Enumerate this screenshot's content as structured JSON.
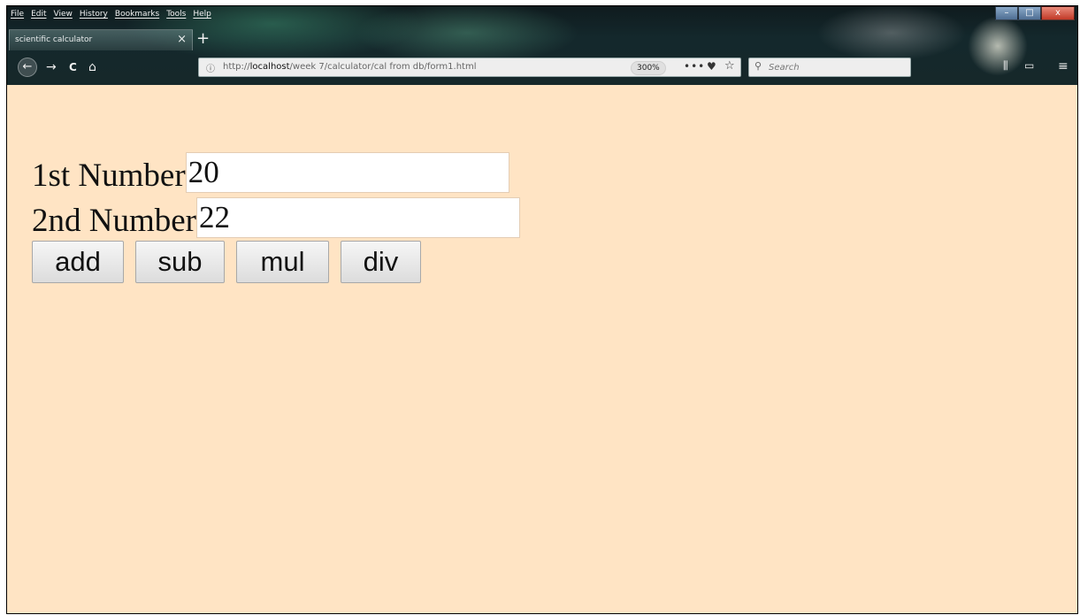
{
  "menubar": {
    "items": [
      "File",
      "Edit",
      "View",
      "History",
      "Bookmarks",
      "Tools",
      "Help"
    ]
  },
  "tab": {
    "title": "scientific calculator",
    "close_glyph": "×",
    "new_tab_glyph": "+"
  },
  "nav": {
    "back_glyph": "←",
    "forward_glyph": "→",
    "reload_glyph": "C",
    "home_glyph": "⌂",
    "url_prefix": "http://",
    "url_host": "localhost",
    "url_path": "/week 7/calculator/cal from db/form1.html",
    "zoom": "300%",
    "page_actions_glyph": "•••",
    "search_placeholder": "Search",
    "menu_glyph": "≡"
  },
  "form": {
    "first_label": "1st Number",
    "first_value": "20",
    "second_label": "2nd Number",
    "second_value": "22",
    "buttons": {
      "add": "add",
      "sub": "sub",
      "mul": "mul",
      "div": "div"
    }
  },
  "colors": {
    "page_background": "#ffe4c4",
    "input_background": "#ffffff"
  },
  "icons": [
    "back-icon",
    "forward-icon",
    "reload-icon",
    "home-icon",
    "info-icon",
    "pocket-icon",
    "star-icon",
    "search-icon",
    "menu-icon",
    "close-icon",
    "plus-icon"
  ]
}
